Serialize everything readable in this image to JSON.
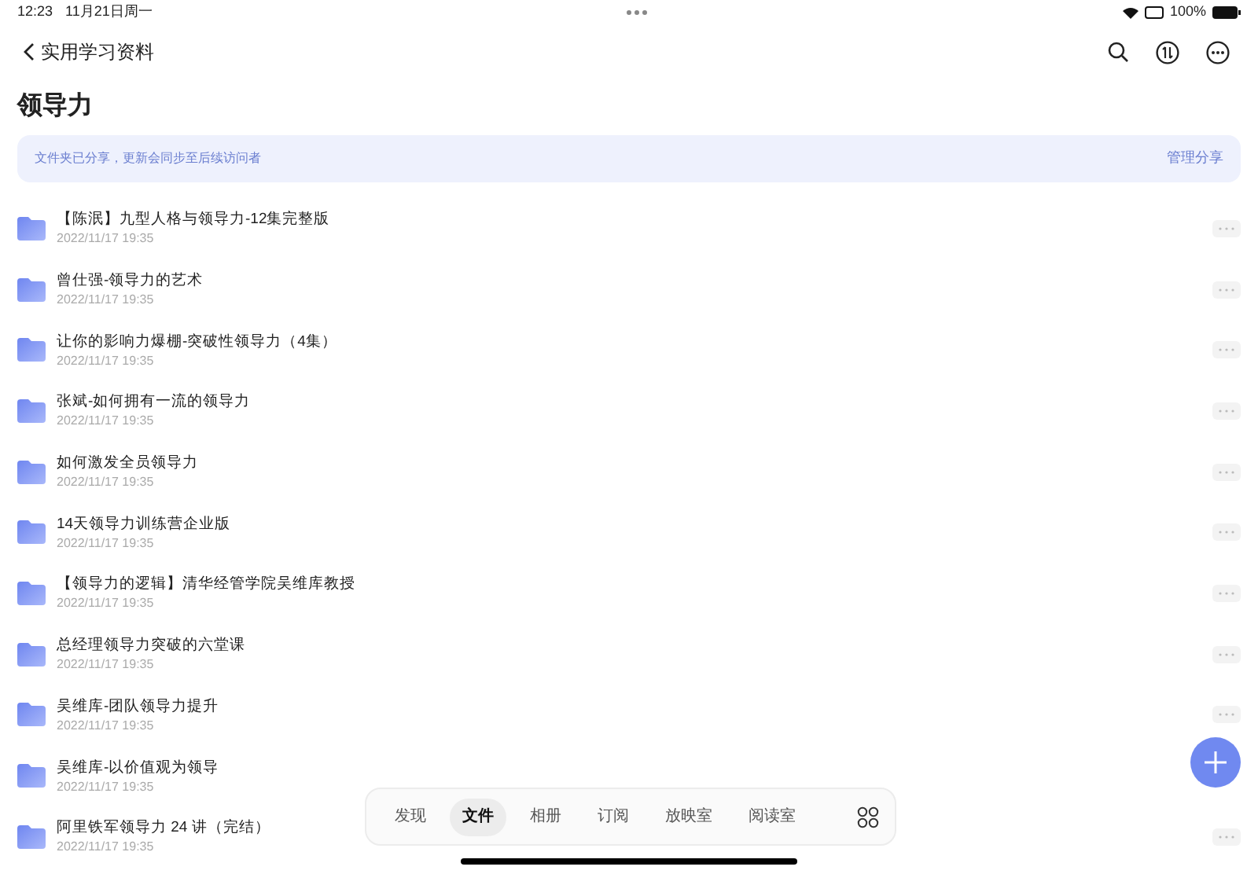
{
  "status_bar": {
    "time": "12:23",
    "date": "11月21日周一",
    "battery": "100%"
  },
  "nav": {
    "back_label": "实用学习资料"
  },
  "title": "领导力",
  "banner": {
    "text": "文件夹已分享，更新会同步至后续访问者",
    "action": "管理分享"
  },
  "files": [
    {
      "name": "【陈泯】九型人格与领导力-12集完整版",
      "date": "2022/11/17 19:35",
      "more_visible": true
    },
    {
      "name": "曾仕强-领导力的艺术",
      "date": "2022/11/17 19:35",
      "more_visible": true
    },
    {
      "name": "让你的影响力爆棚-突破性领导力（4集）",
      "date": "2022/11/17 19:35",
      "more_visible": true
    },
    {
      "name": "张斌-如何拥有一流的领导力",
      "date": "2022/11/17 19:35",
      "more_visible": true
    },
    {
      "name": "如何激发全员领导力",
      "date": "2022/11/17 19:35",
      "more_visible": true
    },
    {
      "name": "14天领导力训练营企业版",
      "date": "2022/11/17 19:35",
      "more_visible": true
    },
    {
      "name": "【领导力的逻辑】清华经管学院吴维库教授",
      "date": "2022/11/17 19:35",
      "more_visible": true
    },
    {
      "name": "总经理领导力突破的六堂课",
      "date": "2022/11/17 19:35",
      "more_visible": true
    },
    {
      "name": "吴维库-团队领导力提升",
      "date": "2022/11/17 19:35",
      "more_visible": true
    },
    {
      "name": "吴维库-以价值观为领导",
      "date": "2022/11/17 19:35",
      "more_visible": false
    },
    {
      "name": "阿里铁军领导力 24 讲（完结）",
      "date": "2022/11/17 19:35",
      "more_visible": true
    }
  ],
  "tabs": [
    {
      "label": "发现",
      "selected": false
    },
    {
      "label": "文件",
      "selected": true
    },
    {
      "label": "相册",
      "selected": false
    },
    {
      "label": "订阅",
      "selected": false
    },
    {
      "label": "放映室",
      "selected": false
    },
    {
      "label": "阅读室",
      "selected": false
    }
  ]
}
